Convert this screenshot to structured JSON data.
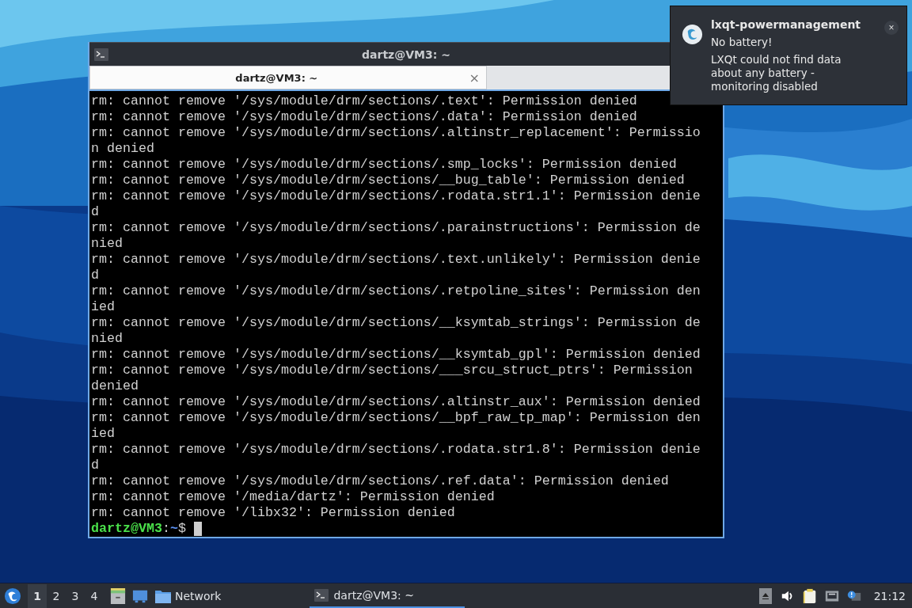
{
  "terminal_window": {
    "title": "dartz@VM3: ~",
    "tabs": [
      {
        "label": "dartz@VM3: ~",
        "selected": true,
        "close": "×"
      }
    ],
    "lines": [
      "rm: cannot remove '/sys/module/drm/sections/.text': Permission denied",
      "rm: cannot remove '/sys/module/drm/sections/.data': Permission denied",
      "rm: cannot remove '/sys/module/drm/sections/.altinstr_replacement': Permissio",
      "n denied",
      "rm: cannot remove '/sys/module/drm/sections/.smp_locks': Permission denied",
      "rm: cannot remove '/sys/module/drm/sections/__bug_table': Permission denied",
      "rm: cannot remove '/sys/module/drm/sections/.rodata.str1.1': Permission denie",
      "d",
      "rm: cannot remove '/sys/module/drm/sections/.parainstructions': Permission de",
      "nied",
      "rm: cannot remove '/sys/module/drm/sections/.text.unlikely': Permission denie",
      "d",
      "rm: cannot remove '/sys/module/drm/sections/.retpoline_sites': Permission den",
      "ied",
      "rm: cannot remove '/sys/module/drm/sections/__ksymtab_strings': Permission de",
      "nied",
      "rm: cannot remove '/sys/module/drm/sections/__ksymtab_gpl': Permission denied",
      "rm: cannot remove '/sys/module/drm/sections/___srcu_struct_ptrs': Permission",
      "denied",
      "rm: cannot remove '/sys/module/drm/sections/.altinstr_aux': Permission denied",
      "rm: cannot remove '/sys/module/drm/sections/__bpf_raw_tp_map': Permission den",
      "ied",
      "rm: cannot remove '/sys/module/drm/sections/.rodata.str1.8': Permission denie",
      "d",
      "rm: cannot remove '/sys/module/drm/sections/.ref.data': Permission denied",
      "rm: cannot remove '/media/dartz': Permission denied",
      "rm: cannot remove '/libx32': Permission denied"
    ],
    "prompt": {
      "user": "dartz@VM3",
      "separator": ":",
      "path": "~",
      "symbol": "$"
    }
  },
  "notification": {
    "app": "lxqt-powermanagement",
    "close": "×",
    "summary": "No battery!",
    "body": "LXQt could not find data about any battery - monitoring disabled"
  },
  "taskbar": {
    "workspaces": [
      {
        "label": "1",
        "selected": true
      },
      {
        "label": "2",
        "selected": false
      },
      {
        "label": "3",
        "selected": false
      },
      {
        "label": "4",
        "selected": false
      }
    ],
    "quicklaunch_label": "Network",
    "tasks": [
      {
        "label": "dartz@VM3: ~",
        "selected": true
      }
    ],
    "clock": "21:12"
  }
}
